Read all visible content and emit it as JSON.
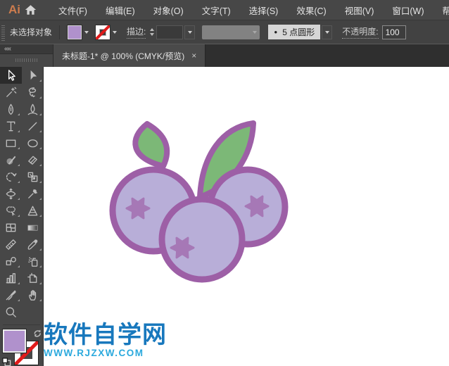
{
  "app": {
    "logo_text": "Ai"
  },
  "menu": {
    "items": [
      "文件(F)",
      "编辑(E)",
      "对象(O)",
      "文字(T)",
      "选择(S)",
      "效果(C)",
      "视图(V)",
      "窗口(W)",
      "帮助(H)"
    ]
  },
  "options_bar": {
    "status_text": "未选择对象",
    "stroke_label": "描边:",
    "brush_bullet": "●",
    "brush_style": "5 点圆形",
    "opacity_label": "不透明度:",
    "opacity_value": "100"
  },
  "tab_bar": {
    "collapse_icon": "««",
    "active_tab_title": "未标题-1* @ 100% (CMYK/预览)",
    "close_glyph": "×"
  },
  "toolbar": {
    "selected_tool": "selection",
    "tools": [
      "selection",
      "direct-selection",
      "magic-wand",
      "lasso",
      "pen",
      "curvature",
      "type",
      "line-segment",
      "rectangle",
      "ellipse",
      "shaper",
      "eraser",
      "rotate",
      "scale",
      "width",
      "puppet-warp",
      "shape-builder",
      "perspective-grid",
      "mesh",
      "gradient",
      "measure",
      "eyedropper",
      "blend",
      "symbol-sprayer",
      "column-graph",
      "artboard",
      "slice",
      "hand",
      "zoom"
    ]
  },
  "artwork": {
    "description": "Three light-purple blueberries with six-point star highlights and two green leaves, purple outline"
  },
  "watermark": {
    "title": "软件自学网",
    "url": "WWW.RJZXW.COM"
  },
  "colors": {
    "menu-bg": "#474747",
    "bar-bg": "#424242",
    "tabbar-bg": "#2f2f2f",
    "tab-bg": "#4a4a4a",
    "panel-bg": "#474747",
    "tool-selected-bg": "#2b2b2b",
    "icon-gray": "#bdbdbd",
    "text-light": "#e5e5e5",
    "logo-orange": "#cd7c4e",
    "ui-fill-swatch": "#b091cc",
    "canvas-bg": "#ffffff",
    "berry-fill": "#b8aed8",
    "berry-stroke": "#9d5fa6",
    "star-fill": "#a678b6",
    "leaf-fill": "#7cb877",
    "wm-blue": "#1878bd",
    "wm-cyan": "#2ba9dd",
    "slash-red": "#e01b1b",
    "brush-field-bg": "#d6d6d6",
    "disabled-field": "#828282"
  }
}
